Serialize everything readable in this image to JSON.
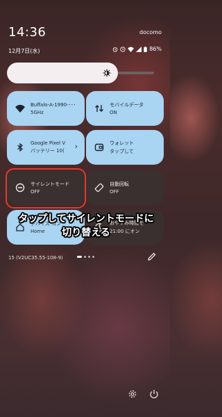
{
  "status_bar": {
    "time": "14:36",
    "carrier": "docomo",
    "date": "12月7日(水)",
    "battery": "86%",
    "icons": [
      "alarm-icon",
      "clock-icon",
      "wifi-icon",
      "signal-icon",
      "battery-icon"
    ]
  },
  "brightness": {
    "level": 0.65
  },
  "tiles": [
    {
      "title": "Buffalo-A-1990-･･･",
      "sub": "5GHz",
      "state": "on",
      "icon": "wifi-icon"
    },
    {
      "title": "モバイルデータ",
      "sub": "ON",
      "state": "on",
      "icon": "data-transfer-icon"
    },
    {
      "title": "Google Pixel V",
      "sub": "バッテリー 10(",
      "state": "on",
      "icon": "bluetooth-icon",
      "chevron": "›"
    },
    {
      "title": "ウォレット",
      "sub": "タップして",
      "state": "on",
      "icon": "wallet-icon"
    },
    {
      "title": "サイレントモード",
      "sub": "OFF",
      "state": "off",
      "icon": "do-not-disturb-icon"
    },
    {
      "title": "自動回転",
      "sub": "OFF",
      "state": "off",
      "icon": "auto-rotate-icon"
    },
    {
      "title": "デバイス コン",
      "sub": "Home",
      "state": "on",
      "icon": "device-controls-icon"
    },
    {
      "title": "おやすみ時間モ",
      "sub": "21:00 にオン",
      "state": "off",
      "icon": "bedtime-icon"
    }
  ],
  "callout": {
    "line1": "タップしてサイレントモードに",
    "line2": "切り替える"
  },
  "footer": {
    "build": "15 (V2UC35.55-108-9)",
    "page_count": 4,
    "active_page": 0
  },
  "colors": {
    "tile_on": "#a9d4f2",
    "tile_off": "#3a3030",
    "highlight": "#e23b2c"
  }
}
